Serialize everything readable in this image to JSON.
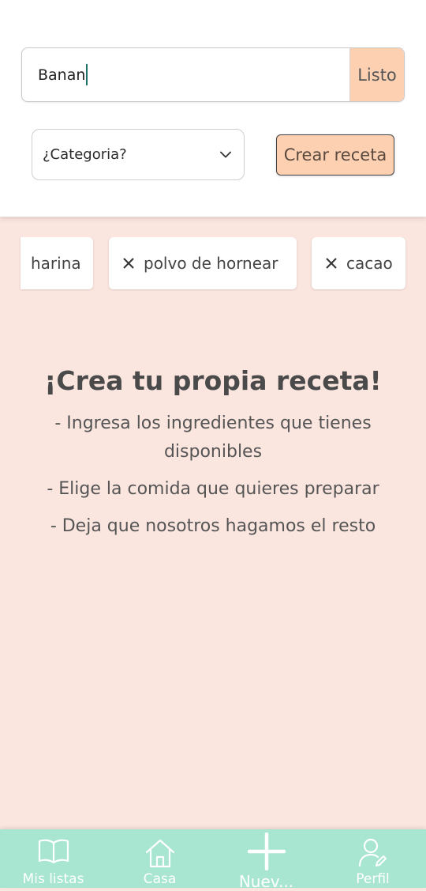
{
  "search": {
    "value": "Banan",
    "done_label": "Listo"
  },
  "category": {
    "selected": "¿Categoria?"
  },
  "create_label": "Crear receta",
  "ingredients": [
    {
      "label": "harina"
    },
    {
      "label": "polvo de hornear"
    },
    {
      "label": "cacao"
    }
  ],
  "intro": {
    "title": "¡Crea tu propia receta!",
    "steps": [
      "- Ingresa los ingredientes que tienes disponibles",
      "- Elige la comida que quieres preparar",
      "- Deja que nosotros hagamos el resto"
    ]
  },
  "nav": [
    {
      "label": "Mis listas",
      "icon": "book-icon"
    },
    {
      "label": "Casa",
      "icon": "home-icon"
    },
    {
      "label": "Nuev...",
      "icon": "plus-icon"
    },
    {
      "label": "Perfil",
      "icon": "profile-edit-icon"
    }
  ],
  "colors": {
    "background": "#fbe5df",
    "accent": "#fdd0b1",
    "nav": "#a8e6d1"
  }
}
